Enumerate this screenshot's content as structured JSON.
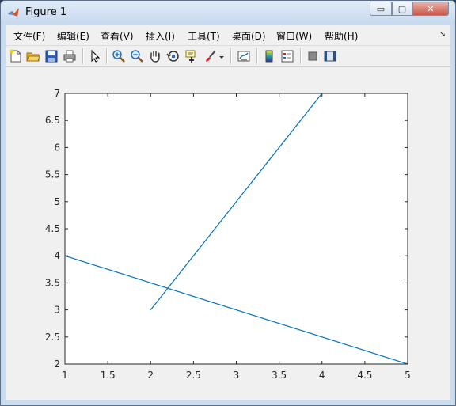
{
  "window": {
    "title": "Figure 1",
    "minimize_label": "▭",
    "maximize_label": "▢",
    "close_label": "✕"
  },
  "menu": {
    "items": [
      "文件(F)",
      "编辑(E)",
      "查看(V)",
      "插入(I)",
      "工具(T)",
      "桌面(D)",
      "窗口(W)",
      "帮助(H)"
    ],
    "overflow_icon": "↘"
  },
  "toolbar": {
    "icons": [
      "new-figure-icon",
      "open-file-icon",
      "save-icon",
      "print-icon",
      "select-arrow-icon",
      "zoom-in-icon",
      "zoom-out-icon",
      "pan-hand-icon",
      "rotate-3d-icon",
      "data-cursor-icon",
      "brush-icon",
      "brush-dropdown-icon",
      "link-plot-icon",
      "colorbar-icon",
      "legend-icon",
      "hide-plot-tools-icon",
      "show-plot-tools-icon"
    ]
  },
  "chart_data": {
    "type": "line",
    "xlim": [
      1,
      5
    ],
    "ylim": [
      2,
      7
    ],
    "xticks": [
      "1",
      "1.5",
      "2",
      "2.5",
      "3",
      "3.5",
      "4",
      "4.5",
      "5"
    ],
    "yticks": [
      "2",
      "2.5",
      "3",
      "3.5",
      "4",
      "4.5",
      "5",
      "5.5",
      "6",
      "6.5",
      "7"
    ],
    "series": [
      {
        "x": [
          2,
          4
        ],
        "y": [
          3,
          7
        ]
      },
      {
        "x": [
          1,
          5
        ],
        "y": [
          4,
          2
        ]
      }
    ],
    "line_color": "#0072bd",
    "grid": false
  }
}
